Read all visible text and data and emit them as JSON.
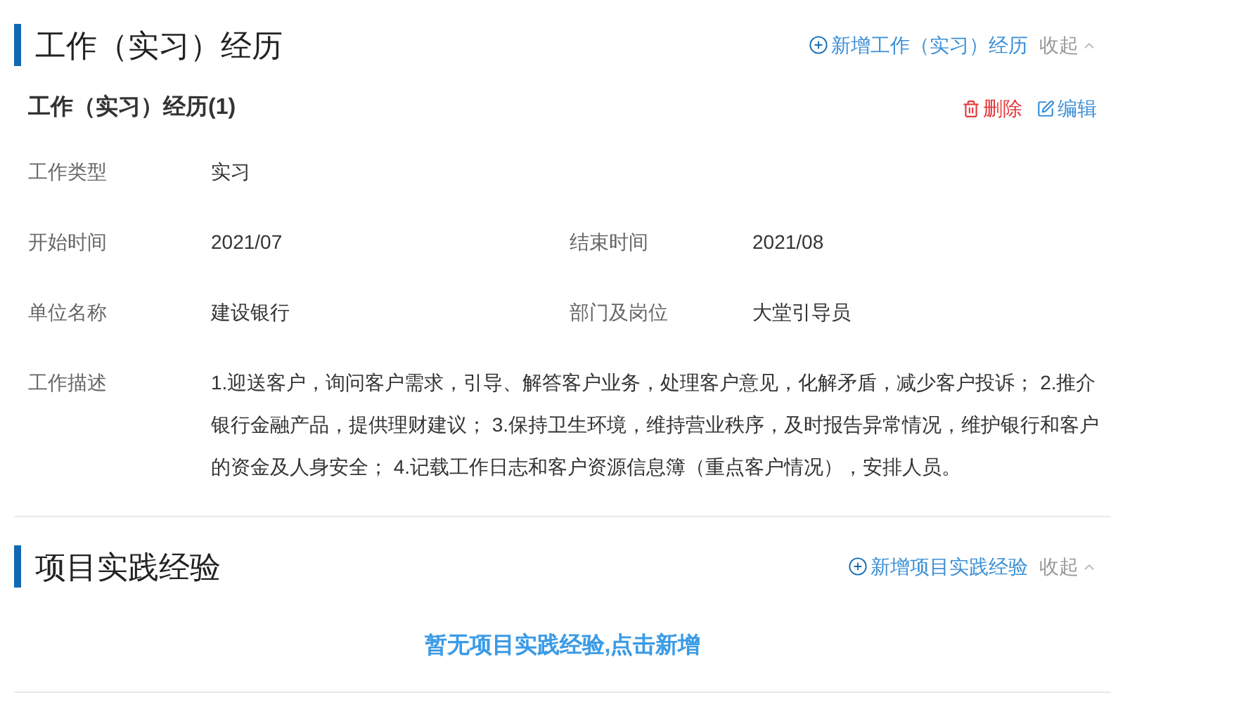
{
  "sections": [
    {
      "title": "工作（实习）经历",
      "add_label": "新增工作（实习）经历",
      "collapse_label": "收起",
      "records": [
        {
          "title": "工作（实习）经历(1)",
          "delete_label": "删除",
          "edit_label": "编辑",
          "rows": [
            [
              {
                "label": "工作类型",
                "value": "实习"
              }
            ],
            [
              {
                "label": "开始时间",
                "value": "2021/07"
              },
              {
                "label": "结束时间",
                "value": "2021/08"
              }
            ],
            [
              {
                "label": "单位名称",
                "value": "建设银行"
              },
              {
                "label": "部门及岗位",
                "value": "大堂引导员"
              }
            ],
            [
              {
                "label": "工作描述",
                "value": "1.迎送客户，询问客户需求，引导、解答客户业务，处理客户意见，化解矛盾，减少客户投诉； 2.推介银行金融产品，提供理财建议； 3.保持卫生环境，维持营业秩序，及时报告异常情况，维护银行和客户的资金及人身安全； 4.记载工作日志和客户资源信息簿（重点客户情况），安排人员。"
              }
            ]
          ]
        }
      ]
    },
    {
      "title": "项目实践经验",
      "add_label": "新增项目实践经验",
      "collapse_label": "收起",
      "empty_message": "暂无项目实践经验,点击新增"
    }
  ]
}
